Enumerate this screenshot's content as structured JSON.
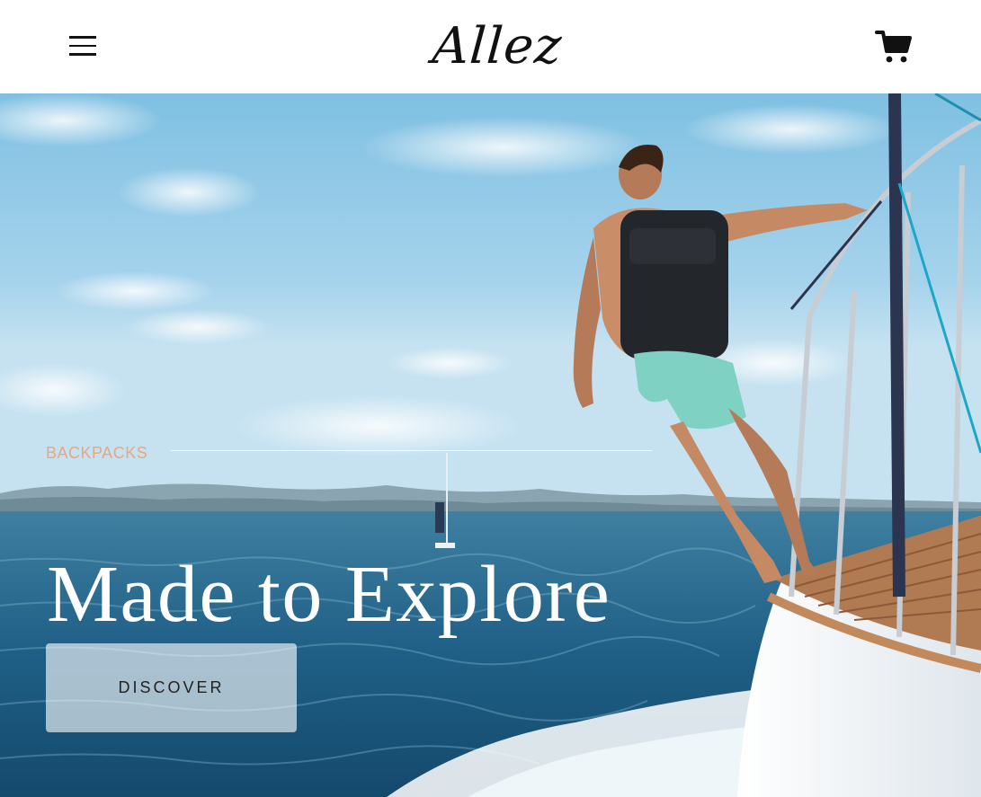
{
  "header": {
    "logo_text": "Allez",
    "menu_icon": "hamburger-menu-icon",
    "cart_icon": "shopping-cart-icon"
  },
  "hero": {
    "category": "BACKPACKS",
    "title": "Made to Explore",
    "cta_label": "DISCOVER"
  },
  "colors": {
    "category_accent": "#e7a780",
    "title_text": "#ffffff",
    "header_bg": "#ffffff"
  }
}
